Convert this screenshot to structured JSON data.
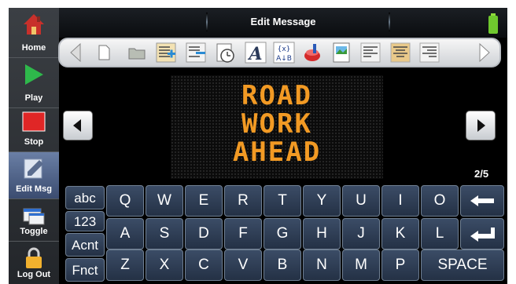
{
  "title": "Edit Message",
  "sidebar": {
    "items": [
      {
        "label": "Home",
        "icon": "house-icon"
      },
      {
        "label": "Play",
        "icon": "play-icon"
      },
      {
        "label": "Stop",
        "icon": "stop-icon"
      },
      {
        "label": "Edit Msg",
        "icon": "pencil-icon"
      },
      {
        "label": "Toggle",
        "icon": "window-toggle-icon"
      },
      {
        "label": "Log Out",
        "icon": "padlock-icon"
      }
    ]
  },
  "toolbar": {
    "icons": [
      "prev-icon",
      "new-page-icon",
      "folder-icon",
      "insert-line-icon",
      "delete-line-icon",
      "clock-icon",
      "font-icon",
      "variable-icon",
      "paint-icon",
      "image-icon",
      "align-left-icon",
      "align-center-icon",
      "align-right-icon",
      "next-icon"
    ],
    "variable_label": "{x}\nA↓B"
  },
  "sign": {
    "lines": [
      "ROAD",
      "WORK",
      "AHEAD"
    ],
    "color": "#f29a24"
  },
  "pager": {
    "indicator": "2/5"
  },
  "keyboard": {
    "modes": [
      "abc",
      "123",
      "Acnt",
      "Fnct"
    ],
    "row1": [
      "Q",
      "W",
      "E",
      "R",
      "T",
      "Y",
      "U",
      "I",
      "O"
    ],
    "row2": [
      "A",
      "S",
      "D",
      "F",
      "G",
      "H",
      "J",
      "K",
      "L"
    ],
    "row3": [
      "Z",
      "X",
      "C",
      "V",
      "B",
      "N",
      "M",
      "P"
    ],
    "backspace_icon": "backspace-arrow-icon",
    "enter_icon": "enter-arrow-icon",
    "space_label": "SPACE"
  }
}
